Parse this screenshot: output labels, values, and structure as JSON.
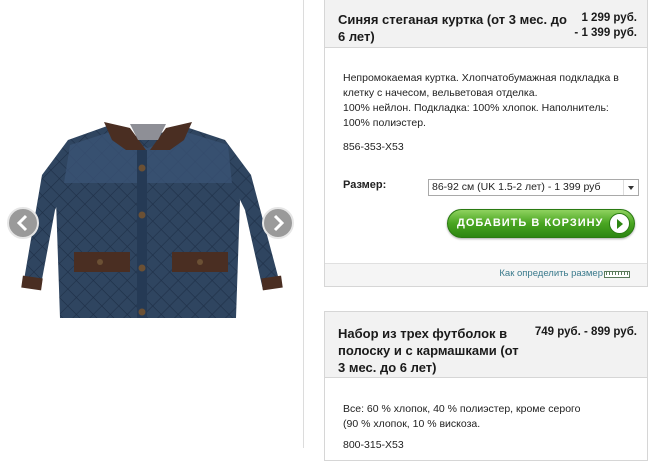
{
  "gallery": {
    "prev_icon": "chevron-left-icon",
    "next_icon": "chevron-right-icon",
    "colors": {
      "jacket": "#2f4560",
      "collar": "#4a2e22",
      "arrow_bg": "#9a9a9a"
    }
  },
  "products": [
    {
      "title_lines": [
        "Синяя стеганая куртка (от 3 мес. до",
        "6 лет)"
      ],
      "price_lines": [
        "1 299 руб.",
        "- 1 399 руб."
      ],
      "description_lines": [
        "Непромокаемая куртка. Хлопчатобумажная подкладка в",
        "клетку с начесом, вельветовая отделка.",
        "100% нейлон. Подкладка: 100% хлопок. Наполнитель:",
        "100% полиэстер."
      ],
      "sku": "856-353-X53",
      "size_label": "Размер:",
      "size_selected": "86-92 см (UK 1.5-2 лет) - 1 399 руб",
      "add_to_cart": "ДОБАВИТЬ В КОРЗИНУ",
      "size_help": "Как определить размер"
    },
    {
      "title_lines": [
        "Набор из трех футболок в",
        "полоску и с кармашками (от",
        "3 мес. до 6 лет)"
      ],
      "price_lines": [
        "749 руб. - 899 руб."
      ],
      "description_lines": [
        "Все: 60 % хлопок, 40 % полиэстер, кроме серого",
        "(90 % хлопок, 10 % вискоза."
      ],
      "sku": "800-315-X53"
    }
  ],
  "accent_color": "#3da01b",
  "link_color": "#3a7a8c"
}
